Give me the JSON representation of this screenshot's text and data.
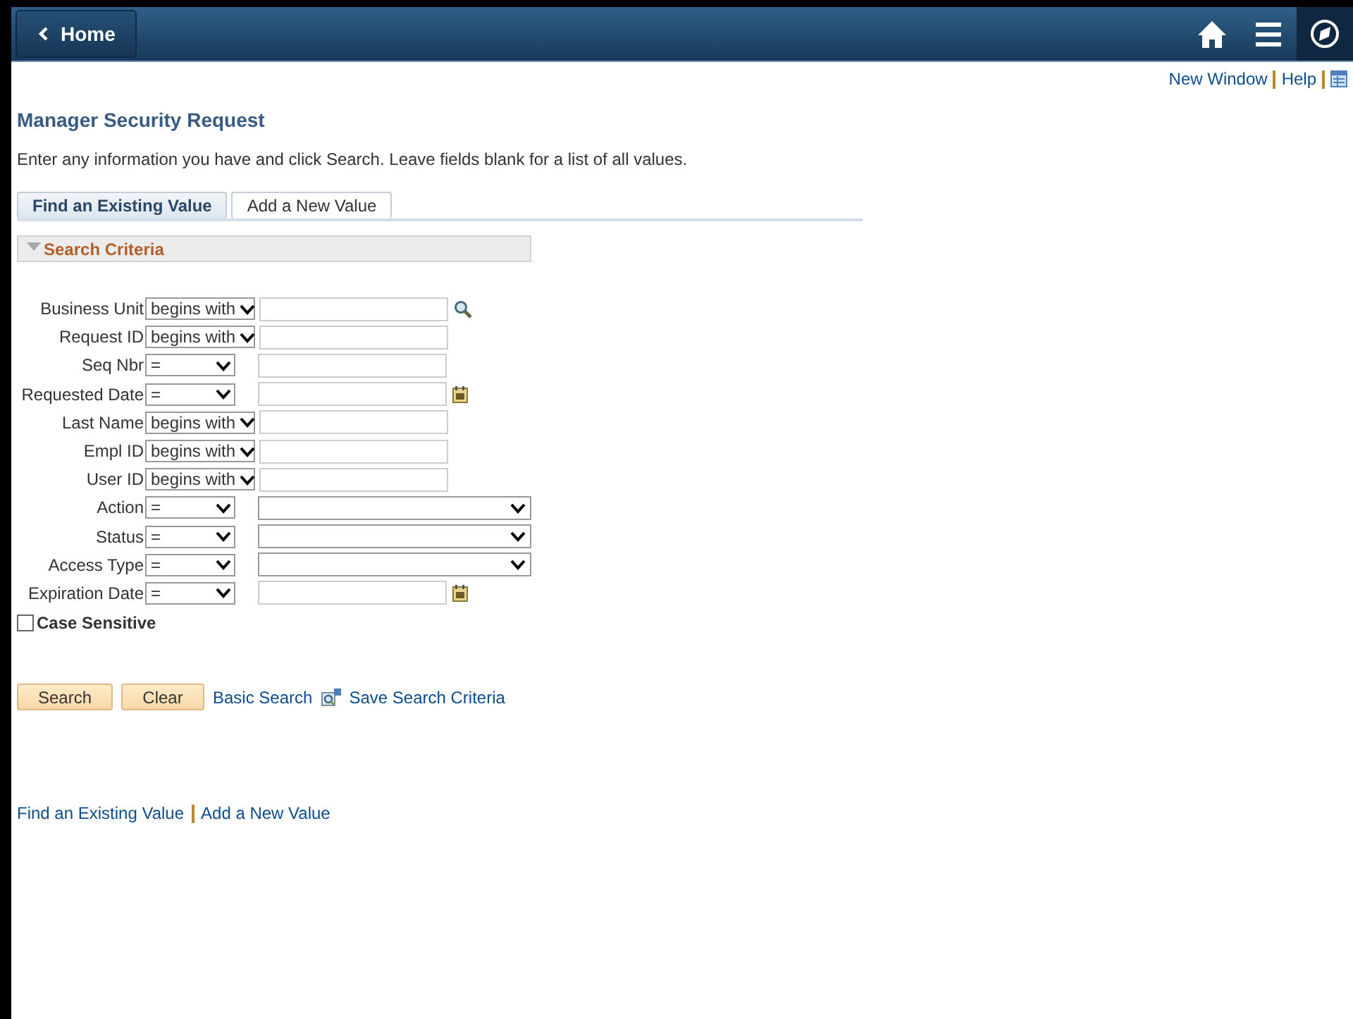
{
  "header": {
    "back_button": "Home"
  },
  "top_links": [
    "New Window",
    "Help"
  ],
  "page_title": "Manager Security Request",
  "instructions": "Enter any information you have and click Search. Leave fields blank for a list of all values.",
  "tabs": [
    {
      "label": "Find an Existing Value",
      "selected": true
    },
    {
      "label": "Add a New Value",
      "selected": false
    }
  ],
  "section": {
    "title": "Search Criteria",
    "expanded": true
  },
  "fields": [
    {
      "label": "Business Unit",
      "operator": "begins with",
      "kind": "lookup"
    },
    {
      "label": "Request ID",
      "operator": "begins with",
      "kind": "text"
    },
    {
      "label": "Seq Nbr",
      "operator": "=",
      "kind": "text"
    },
    {
      "label": "Requested Date",
      "operator": "=",
      "kind": "date"
    },
    {
      "label": "Last Name",
      "operator": "begins with",
      "kind": "text"
    },
    {
      "label": "Empl ID",
      "operator": "begins with",
      "kind": "text"
    },
    {
      "label": "User ID",
      "operator": "begins with",
      "kind": "text"
    },
    {
      "label": "Action",
      "operator": "=",
      "kind": "dropdown"
    },
    {
      "label": "Status",
      "operator": "=",
      "kind": "dropdown"
    },
    {
      "label": "Access Type",
      "operator": "=",
      "kind": "dropdown"
    },
    {
      "label": "Expiration Date",
      "operator": "=",
      "kind": "date"
    }
  ],
  "case_sensitive": {
    "label": "Case Sensitive",
    "checked": false
  },
  "buttons": [
    "Search",
    "Clear"
  ],
  "links": [
    "Basic Search",
    "Save Search Criteria"
  ],
  "footer_links": [
    "Find an Existing Value",
    "Add a New Value"
  ]
}
